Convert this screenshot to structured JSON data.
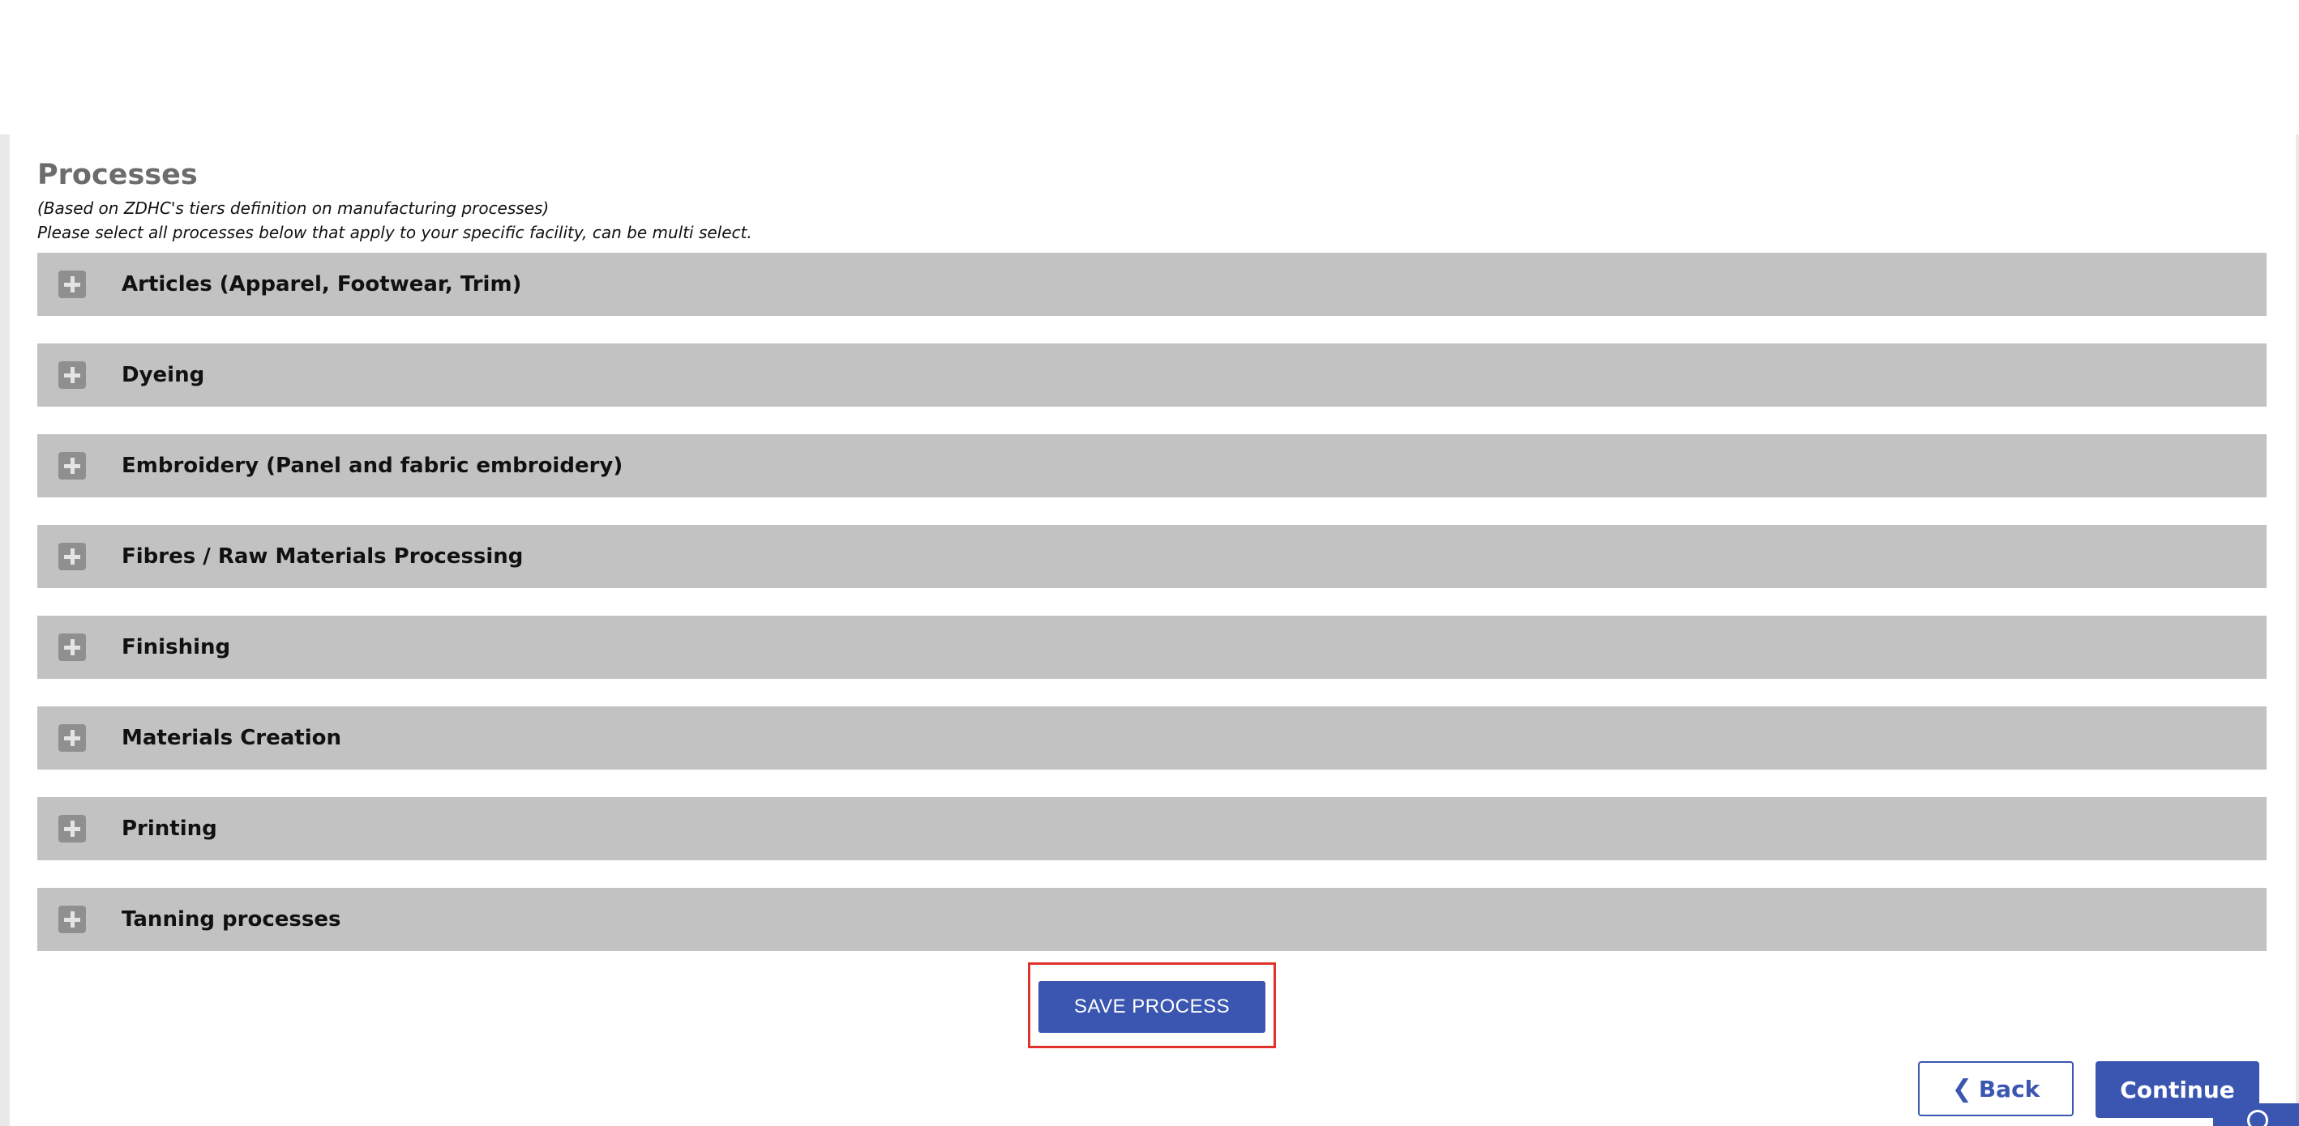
{
  "section": {
    "title": "Processes",
    "note_1": "(Based on ZDHC's tiers definition on manufacturing processes)",
    "note_2": "Please select all processes below that apply to your specific facility, can be multi select."
  },
  "accordion": {
    "items": [
      {
        "label": "Articles (Apparel, Footwear, Trim)",
        "icon": "plus-icon"
      },
      {
        "label": "Dyeing",
        "icon": "plus-icon"
      },
      {
        "label": "Embroidery (Panel and fabric embroidery)",
        "icon": "plus-icon"
      },
      {
        "label": "Fibres / Raw Materials Processing",
        "icon": "plus-icon"
      },
      {
        "label": "Finishing",
        "icon": "plus-icon"
      },
      {
        "label": "Materials Creation",
        "icon": "plus-icon"
      },
      {
        "label": "Printing",
        "icon": "plus-icon"
      },
      {
        "label": "Tanning processes",
        "icon": "plus-icon"
      }
    ]
  },
  "actions": {
    "save_label": "SAVE PROCESS",
    "back_label": "Back",
    "back_icon": "chevron-left-icon",
    "continue_label": "Continue"
  },
  "help": {
    "icon": "help-icon"
  },
  "colors": {
    "accordion_bg": "#c2c2c2",
    "primary": "#3a56b0",
    "highlight": "#e0312b",
    "title": "#6c6c6c"
  }
}
